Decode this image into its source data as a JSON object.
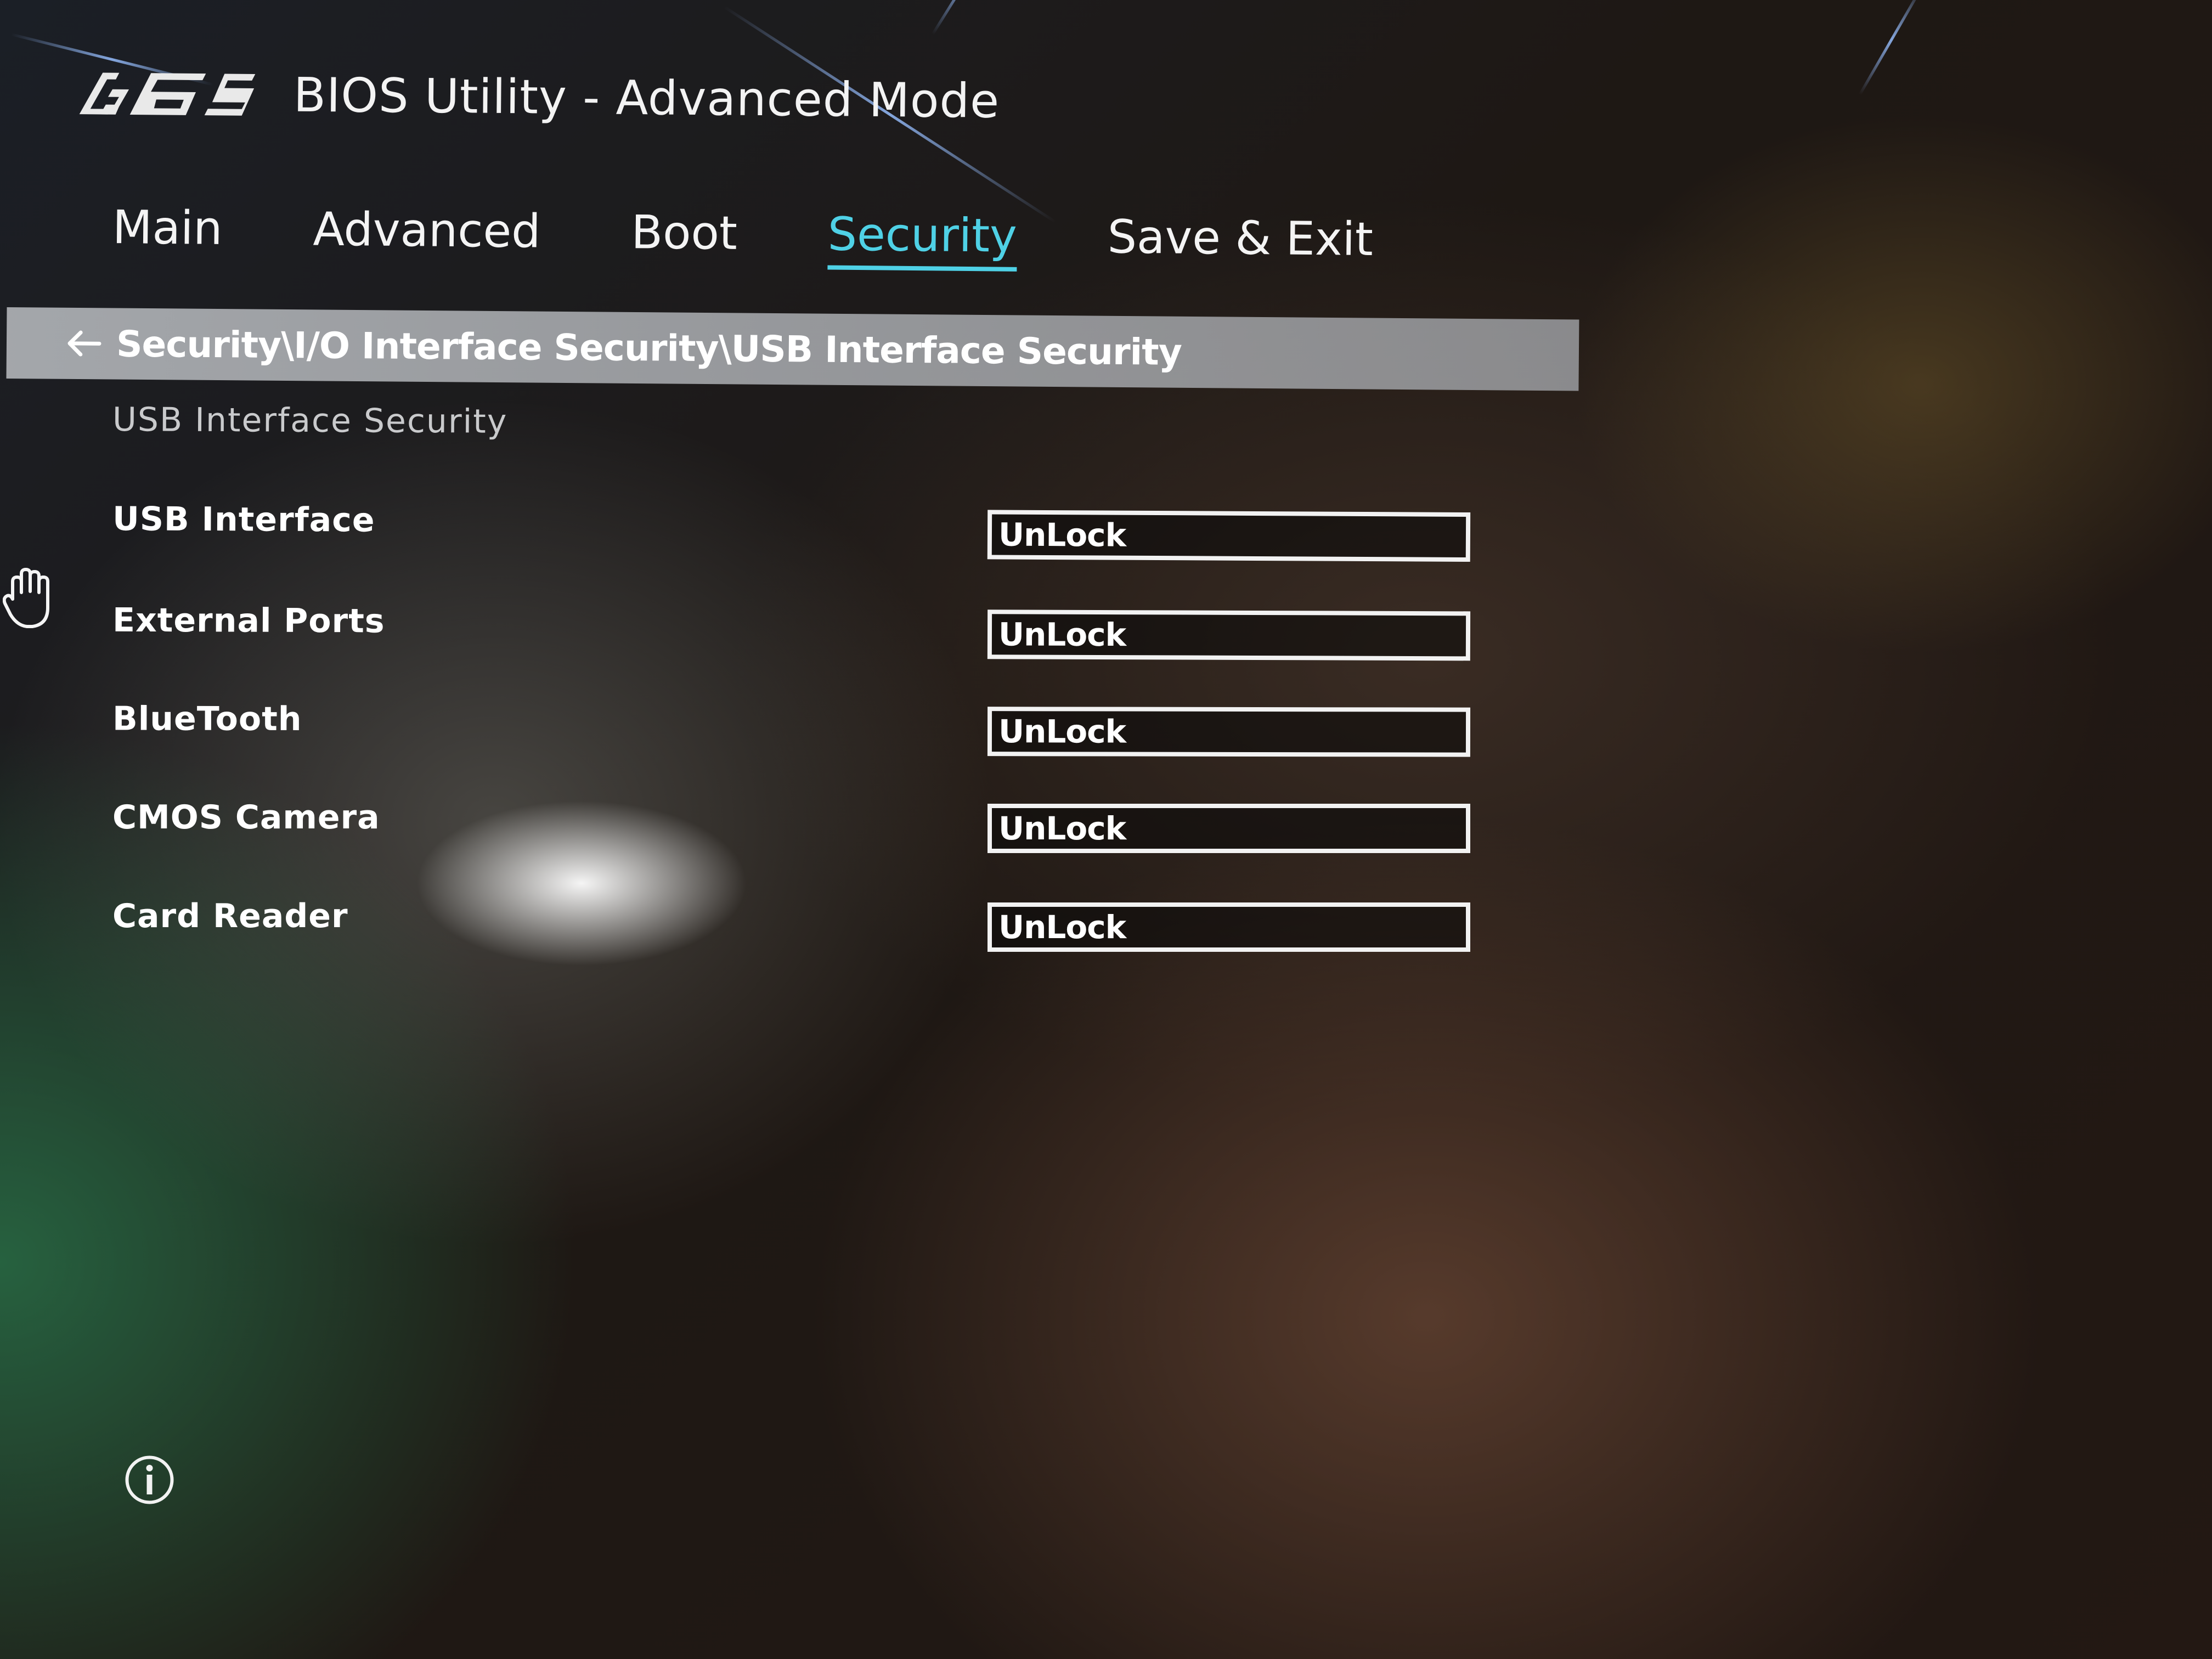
{
  "header": {
    "brand": "ASUS",
    "title": "BIOS Utility - Advanced Mode"
  },
  "tabs": [
    {
      "label": "Main",
      "active": false
    },
    {
      "label": "Advanced",
      "active": false
    },
    {
      "label": "Boot",
      "active": false
    },
    {
      "label": "Security",
      "active": true
    },
    {
      "label": "Save & Exit",
      "active": false
    }
  ],
  "breadcrumb": {
    "path": "Security\\I/O Interface Security\\USB Interface Security"
  },
  "section": {
    "title": "USB Interface Security"
  },
  "settings": [
    {
      "label": "USB Interface",
      "value": "UnLock"
    },
    {
      "label": "External Ports",
      "value": "UnLock"
    },
    {
      "label": "BlueTooth",
      "value": "UnLock"
    },
    {
      "label": "CMOS Camera",
      "value": "UnLock"
    },
    {
      "label": "Card Reader",
      "value": "UnLock"
    }
  ],
  "icons": {
    "logo": "asus-logo",
    "back": "back-arrow-icon",
    "cursor": "hand-cursor-icon",
    "info": "info-icon"
  },
  "colors": {
    "active_tab": "#4fd1e6",
    "text": "#ffffff",
    "breadcrumb_bar": "#aeb1b5"
  }
}
